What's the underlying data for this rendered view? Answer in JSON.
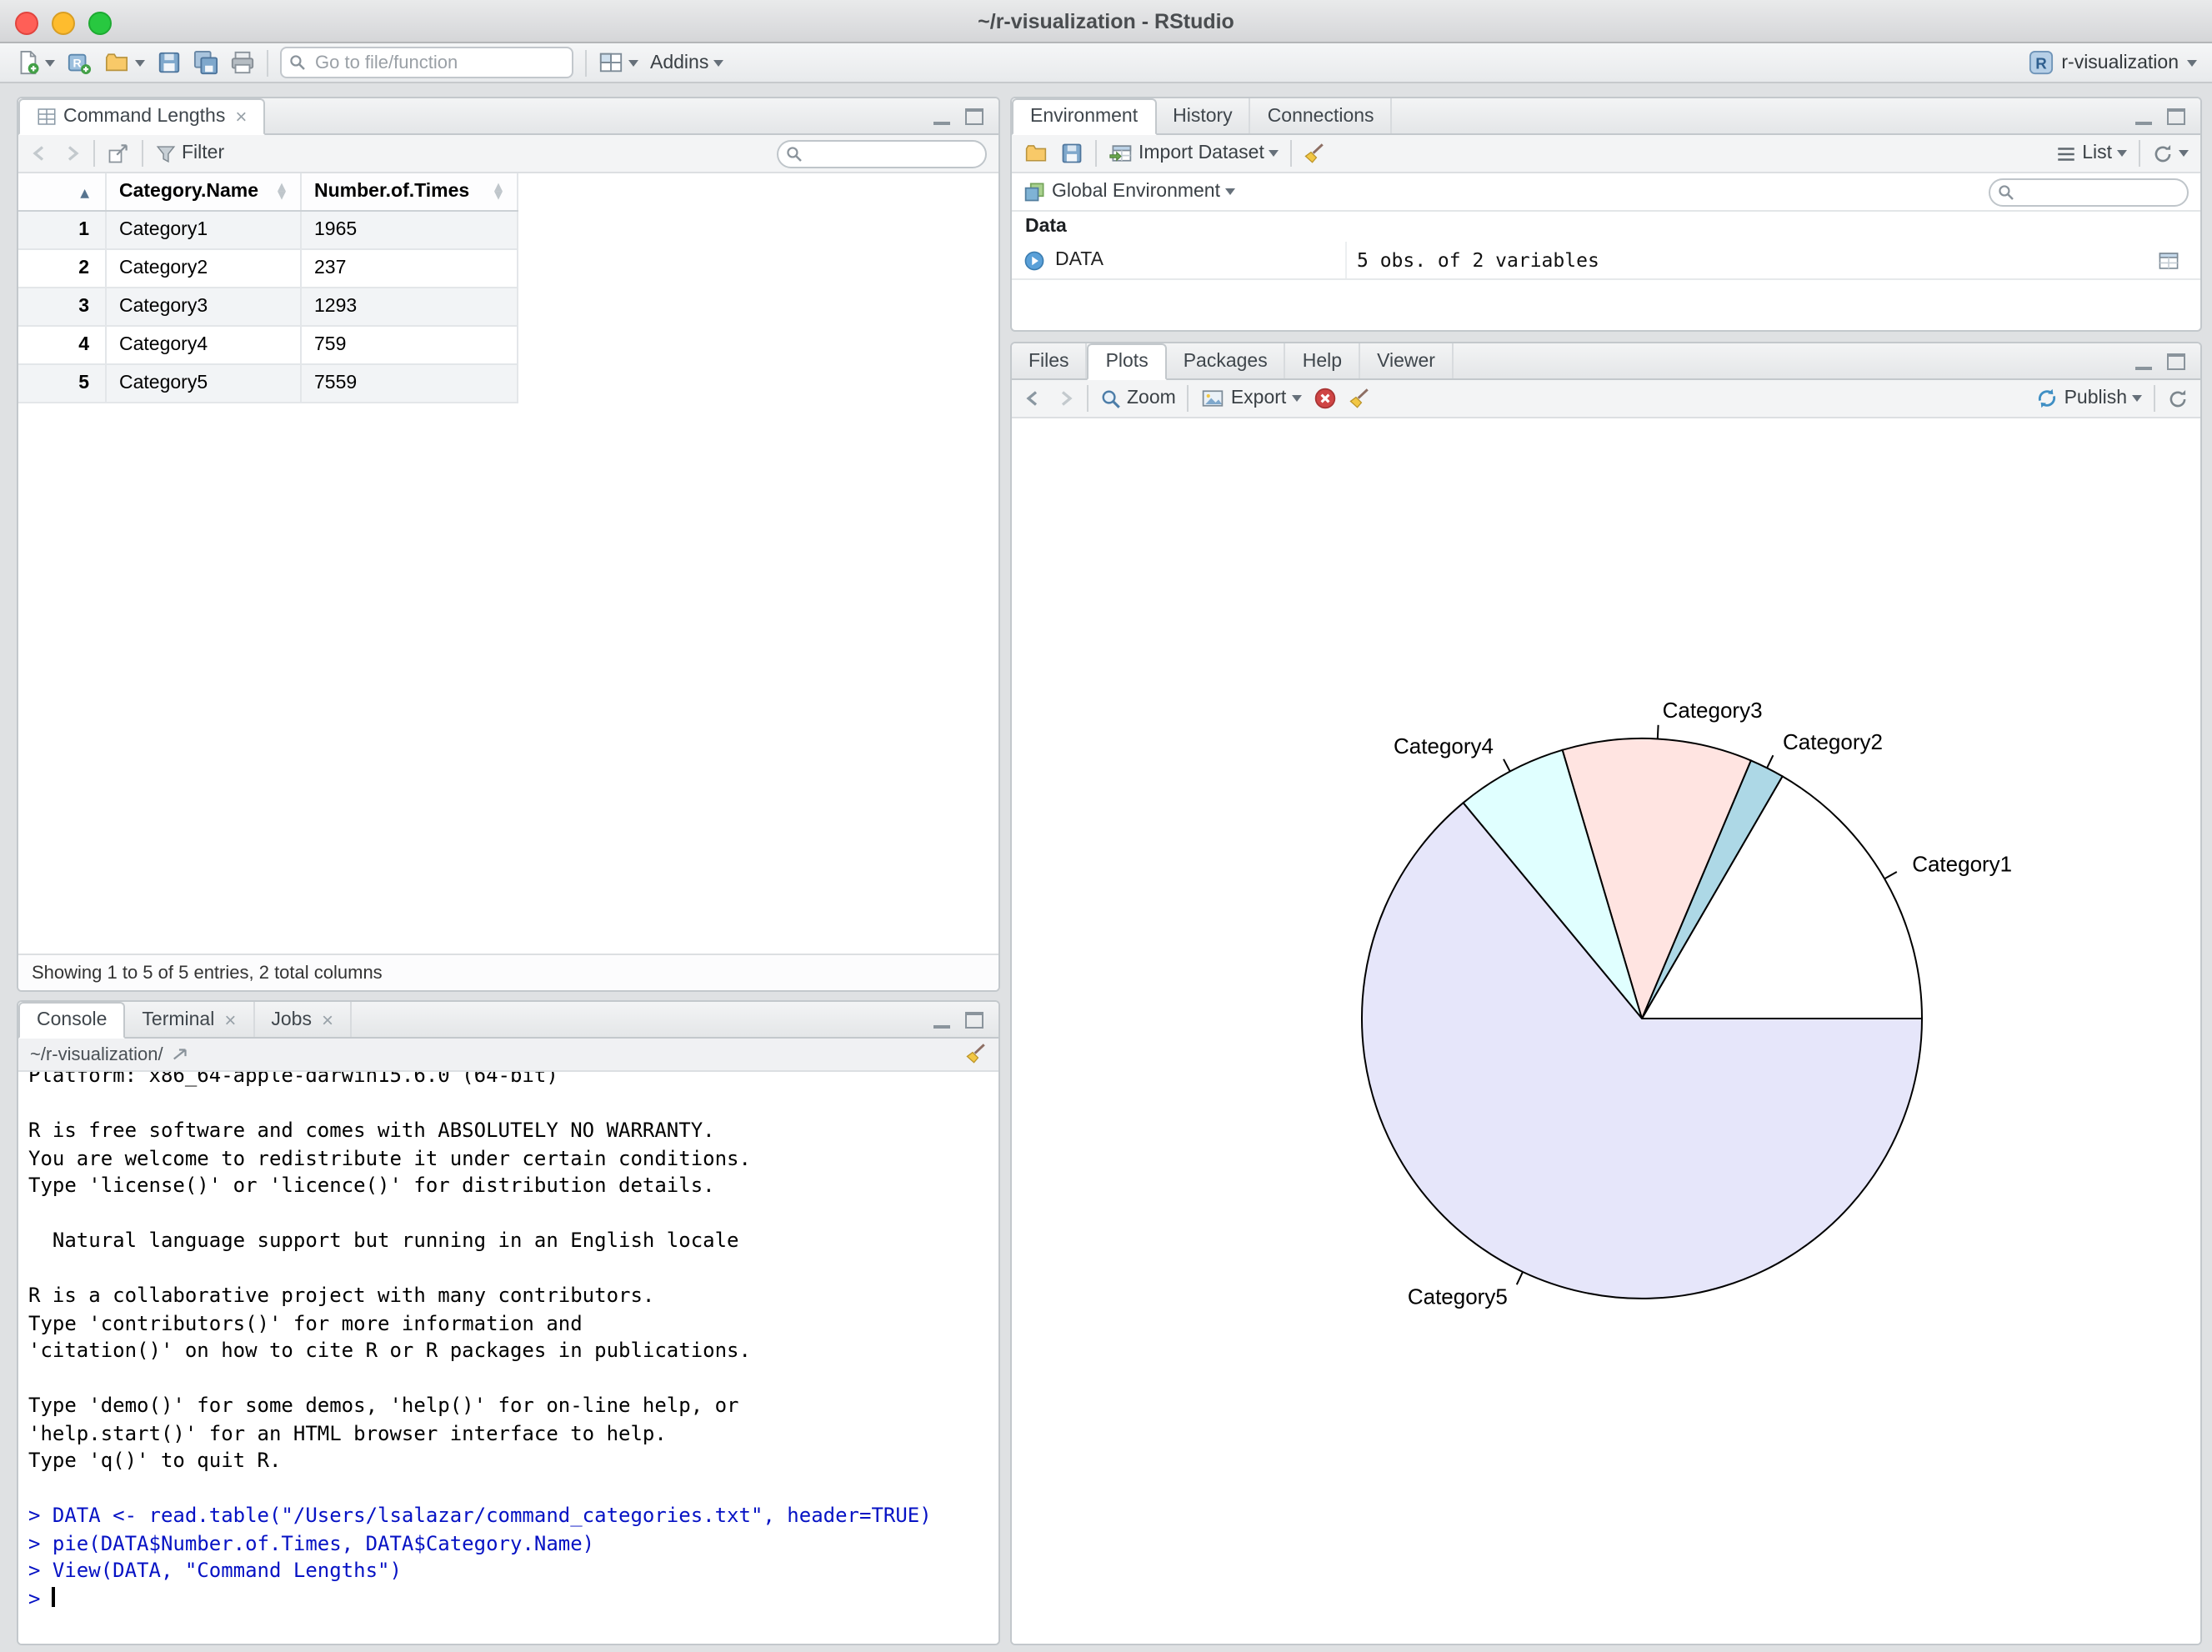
{
  "window": {
    "title": "~/r-visualization - RStudio"
  },
  "main_toolbar": {
    "goto_placeholder": "Go to file/function",
    "addins_label": "Addins",
    "project_label": "r-visualization"
  },
  "icons": [
    "close",
    "minimize",
    "zoom-window",
    "new-file",
    "new-project",
    "open-folder",
    "save",
    "save-all",
    "print",
    "magnifier",
    "panes-grid",
    "r-project",
    "back-arrow",
    "forward-arrow",
    "popout",
    "filter-funnel",
    "grid-table",
    "import-dataset",
    "broom",
    "list",
    "refresh",
    "environment-cube",
    "expand-play",
    "view-data-grid",
    "zoom-magnifier",
    "export-image",
    "delete-plot",
    "publish"
  ],
  "data_viewer": {
    "tab_title": "Command Lengths",
    "filter_label": "Filter",
    "table": {
      "columns": [
        "Category.Name",
        "Number.of.Times"
      ],
      "rows": [
        {
          "n": "1",
          "category": "Category1",
          "times": "1965"
        },
        {
          "n": "2",
          "category": "Category2",
          "times": "237"
        },
        {
          "n": "3",
          "category": "Category3",
          "times": "1293"
        },
        {
          "n": "4",
          "category": "Category4",
          "times": "759"
        },
        {
          "n": "5",
          "category": "Category5",
          "times": "7559"
        }
      ]
    },
    "footer": "Showing 1 to 5 of 5 entries, 2 total columns"
  },
  "console": {
    "tabs": [
      "Console",
      "Terminal",
      "Jobs"
    ],
    "path": "~/r-visualization/",
    "lines": [
      {
        "type": "output",
        "text": "Platform: x86_64-apple-darwin15.6.0 (64-bit)"
      },
      {
        "type": "output",
        "text": ""
      },
      {
        "type": "output",
        "text": "R is free software and comes with ABSOLUTELY NO WARRANTY."
      },
      {
        "type": "output",
        "text": "You are welcome to redistribute it under certain conditions."
      },
      {
        "type": "output",
        "text": "Type 'license()' or 'licence()' for distribution details."
      },
      {
        "type": "output",
        "text": ""
      },
      {
        "type": "output",
        "text": "  Natural language support but running in an English locale"
      },
      {
        "type": "output",
        "text": ""
      },
      {
        "type": "output",
        "text": "R is a collaborative project with many contributors."
      },
      {
        "type": "output",
        "text": "Type 'contributors()' for more information and"
      },
      {
        "type": "output",
        "text": "'citation()' on how to cite R or R packages in publications."
      },
      {
        "type": "output",
        "text": ""
      },
      {
        "type": "output",
        "text": "Type 'demo()' for some demos, 'help()' for on-line help, or"
      },
      {
        "type": "output",
        "text": "'help.start()' for an HTML browser interface to help."
      },
      {
        "type": "output",
        "text": "Type 'q()' to quit R."
      },
      {
        "type": "output",
        "text": ""
      },
      {
        "type": "command",
        "text": "> DATA <- read.table(\"/Users/lsalazar/command_categories.txt\", header=TRUE)"
      },
      {
        "type": "command",
        "text": "> pie(DATA$Number.of.Times, DATA$Category.Name)"
      },
      {
        "type": "command",
        "text": "> View(DATA, \"Command Lengths\")"
      },
      {
        "type": "prompt",
        "text": ">"
      }
    ]
  },
  "environment": {
    "tabs": [
      "Environment",
      "History",
      "Connections"
    ],
    "import_label": "Import Dataset",
    "list_label": "List",
    "scope_label": "Global Environment",
    "section_label": "Data",
    "entries": [
      {
        "name": "DATA",
        "value": "5 obs. of 2 variables"
      }
    ]
  },
  "plots": {
    "tabs": [
      "Files",
      "Plots",
      "Packages",
      "Help",
      "Viewer"
    ],
    "zoom_label": "Zoom",
    "export_label": "Export",
    "publish_label": "Publish"
  },
  "chart_data": {
    "type": "pie",
    "title": "",
    "categories": [
      "Category1",
      "Category2",
      "Category3",
      "Category4",
      "Category5"
    ],
    "values": [
      1965,
      237,
      1293,
      759,
      7559
    ],
    "colors": [
      "#FFFFFF",
      "#ADD8E6",
      "#FFE4E1",
      "#E0FFFF",
      "#E6E6FA"
    ],
    "edge_color": "#000000",
    "start_angle_deg": 0,
    "direction": "counterclockwise",
    "legend": "none",
    "labels_from": "categories"
  }
}
